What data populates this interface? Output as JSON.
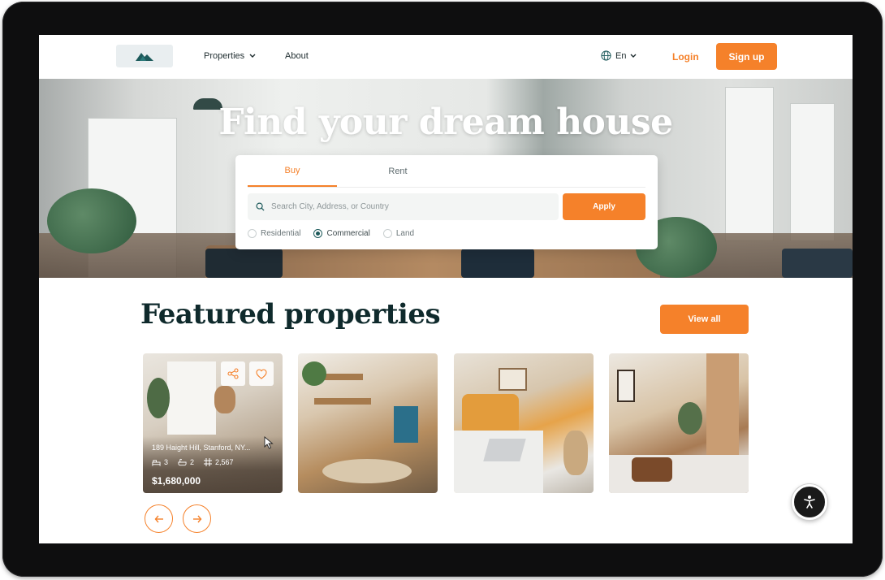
{
  "header": {
    "nav": [
      {
        "label": "Properties"
      },
      {
        "label": "About"
      }
    ],
    "language": "En",
    "login_label": "Login",
    "signup_label": "Sign up"
  },
  "hero": {
    "title": "Find your dream house"
  },
  "search": {
    "tabs": [
      {
        "label": "Buy",
        "active": true
      },
      {
        "label": "Rent",
        "active": false
      }
    ],
    "placeholder": "Search City, Address, or Country",
    "apply_label": "Apply",
    "property_types": [
      {
        "label": "Residential",
        "checked": false
      },
      {
        "label": "Commercial",
        "checked": true
      },
      {
        "label": "Land",
        "checked": false
      }
    ]
  },
  "featured": {
    "title": "Featured properties",
    "view_all_label": "View all",
    "cards": [
      {
        "address": "189 Haight Hill, Stanford, NY...",
        "beds": "3",
        "baths": "2",
        "area": "2,567",
        "price": "$1,680,000"
      },
      {},
      {},
      {}
    ]
  },
  "colors": {
    "accent": "#f5812a",
    "dark": "#0f2a2c",
    "teal": "#1d5a5b"
  }
}
